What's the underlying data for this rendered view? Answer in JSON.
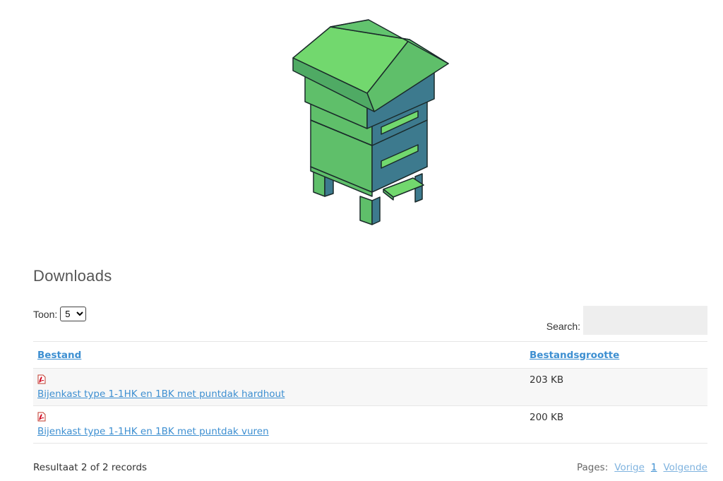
{
  "hero": {
    "image_subject": "beehive-illustration"
  },
  "downloads": {
    "heading": "Downloads",
    "length": {
      "label": "Toon:",
      "selected": "5",
      "options": [
        "5"
      ]
    },
    "search": {
      "label": "Search:",
      "value": "",
      "placeholder": ""
    },
    "table": {
      "headers": {
        "file": "Bestand",
        "size": "Bestandsgrootte"
      },
      "rows": [
        {
          "icon": "pdf-icon",
          "name": "Bijenkast type 1-1HK en 1BK met puntdak hardhout",
          "size": "203 KB"
        },
        {
          "icon": "pdf-icon",
          "name": "Bijenkast type 1-1HK en 1BK met puntdak vuren",
          "size": "200 KB"
        }
      ]
    },
    "info": "Resultaat 2 of 2 records",
    "pager": {
      "label": "Pages:",
      "prev": "Vorige",
      "current": "1",
      "next": "Volgende"
    }
  },
  "colors": {
    "link": "#3d8fd1",
    "hive_green": "#72d86e",
    "hive_teal": "#3d7a8e"
  }
}
